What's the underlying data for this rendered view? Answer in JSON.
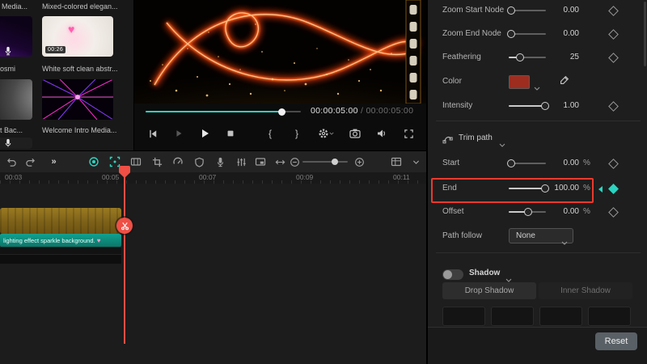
{
  "app": {
    "accent_color": "#2bd4c0",
    "annotation_color": "#ea3a2d"
  },
  "media_panel": {
    "label_row1_left": "Media...",
    "label_row1_main": "Mixed-colored elegan...",
    "thumb1_duration": "00:26",
    "label_row2_left": "osmi",
    "label_row2_main": "White soft clean abstr...",
    "label_row3_left": "t Bac...",
    "label_row3_main": "Welcome Intro Media..."
  },
  "preview": {
    "current_time": "00:00:05:00",
    "time_separator": "/",
    "total_time": "00:00:05:00",
    "mark_in": "{",
    "mark_out": "}"
  },
  "timeline": {
    "expand_label": "»",
    "ruler_labels": [
      "00:03",
      "00:05",
      "00:07",
      "00:09",
      "00:11"
    ],
    "clip_label": "lighting effect sparkle background.",
    "clip_heart": "♥"
  },
  "properties": {
    "rows": [
      {
        "label": "Zoom Start Node",
        "value": "0.00"
      },
      {
        "label": "Zoom End Node",
        "value": "0.00"
      },
      {
        "label": "Feathering",
        "value": "25"
      },
      {
        "label": "Color"
      },
      {
        "label": "Intensity",
        "value": "1.00"
      }
    ],
    "trim": {
      "header": "Trim path",
      "rows": [
        {
          "label": "Start",
          "value": "0.00",
          "unit": "%"
        },
        {
          "label": "End",
          "value": "100.00",
          "unit": "%"
        },
        {
          "label": "Offset",
          "value": "0.00",
          "unit": "%"
        }
      ],
      "path_follow_label": "Path follow",
      "path_follow_value": "None"
    },
    "shadow": {
      "header": "Shadow",
      "tabs": [
        {
          "label": "Drop Shadow"
        },
        {
          "label": "Inner Shadow"
        }
      ]
    },
    "reset_label": "Reset"
  }
}
